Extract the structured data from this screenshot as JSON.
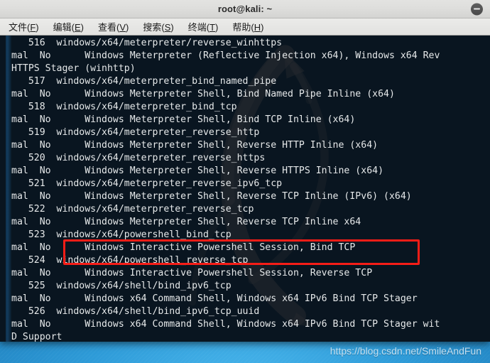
{
  "window": {
    "title": "root@kali: ~",
    "minimize_label": "minimize"
  },
  "menubar": {
    "items": [
      {
        "label": "文件(F)",
        "text": "文件(",
        "mnemonic": "F",
        "tail": ")",
        "name": "menu-file"
      },
      {
        "label": "编辑(E)",
        "text": "编辑(",
        "mnemonic": "E",
        "tail": ")",
        "name": "menu-edit"
      },
      {
        "label": "查看(V)",
        "text": "查看(",
        "mnemonic": "V",
        "tail": ")",
        "name": "menu-view"
      },
      {
        "label": "搜索(S)",
        "text": "搜索(",
        "mnemonic": "S",
        "tail": ")",
        "name": "menu-search"
      },
      {
        "label": "终端(T)",
        "text": "终端(",
        "mnemonic": "T",
        "tail": ")",
        "name": "menu-terminal"
      },
      {
        "label": "帮助(H)",
        "text": "帮助(",
        "mnemonic": "H",
        "tail": ")",
        "name": "menu-help"
      }
    ]
  },
  "terminal": {
    "background_color": "#091520",
    "foreground_color": "#e6e9ea",
    "lines": [
      "   516  windows/x64/meterpreter/reverse_winhttps",
      "mal  No      Windows Meterpreter (Reflective Injection x64), Windows x64 Rev",
      "HTTPS Stager (winhttp)",
      "   517  windows/x64/meterpreter_bind_named_pipe",
      "mal  No      Windows Meterpreter Shell, Bind Named Pipe Inline (x64)",
      "   518  windows/x64/meterpreter_bind_tcp",
      "mal  No      Windows Meterpreter Shell, Bind TCP Inline (x64)",
      "   519  windows/x64/meterpreter_reverse_http",
      "mal  No      Windows Meterpreter Shell, Reverse HTTP Inline (x64)",
      "   520  windows/x64/meterpreter_reverse_https",
      "mal  No      Windows Meterpreter Shell, Reverse HTTPS Inline (x64)",
      "   521  windows/x64/meterpreter_reverse_ipv6_tcp",
      "mal  No      Windows Meterpreter Shell, Reverse TCP Inline (IPv6) (x64)",
      "   522  windows/x64/meterpreter_reverse_tcp",
      "mal  No      Windows Meterpreter Shell, Reverse TCP Inline x64",
      "   523  windows/x64/powershell_bind_tcp",
      "mal  No      Windows Interactive Powershell Session, Bind TCP",
      "   524  windows/x64/powershell_reverse_tcp",
      "mal  No      Windows Interactive Powershell Session, Reverse TCP",
      "   525  windows/x64/shell/bind_ipv6_tcp",
      "mal  No      Windows x64 Command Shell, Windows x64 IPv6 Bind TCP Stager",
      "   526  windows/x64/shell/bind_ipv6_tcp_uuid",
      "mal  No      Windows x64 Command Shell, Windows x64 IPv6 Bind TCP Stager wit",
      "D Support"
    ]
  },
  "annotation": {
    "highlight_color": "#f61d17",
    "highlighted_lines": [
      "   522  windows/x64/meterpreter_reverse_tcp",
      "mal  No      Windows Meterpreter Shell, Reverse TCP Inline x64"
    ]
  },
  "watermark": {
    "text": "https://blog.csdn.net/SmileAndFun"
  }
}
